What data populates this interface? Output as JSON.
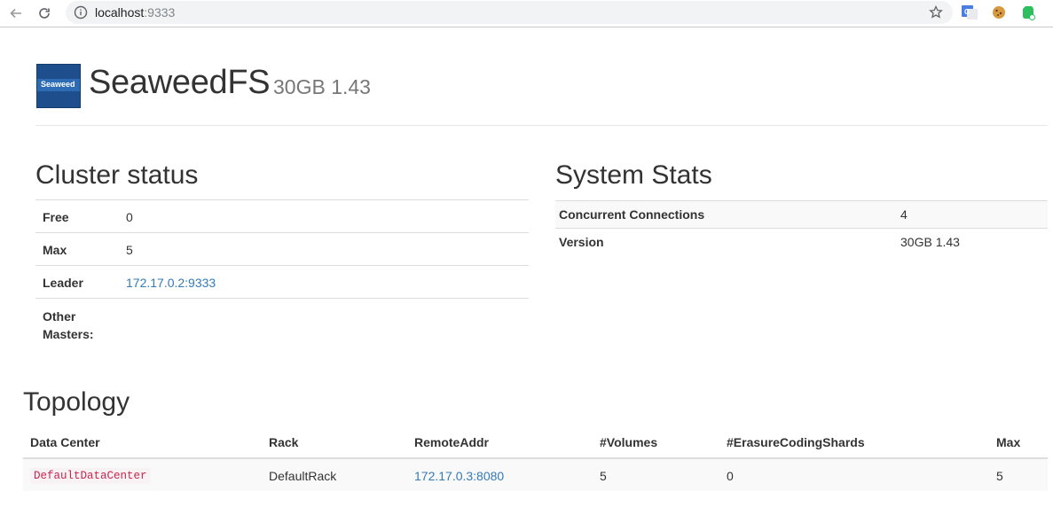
{
  "browser": {
    "url_host": "localhost",
    "url_port": ":9333"
  },
  "header": {
    "logo_text": "Seaweed",
    "title": "SeaweedFS",
    "subtitle": "30GB 1.43"
  },
  "cluster_status": {
    "heading": "Cluster status",
    "rows": [
      {
        "label": "Free",
        "value": "0"
      },
      {
        "label": "Max",
        "value": "5"
      },
      {
        "label": "Leader",
        "value": "172.17.0.2:9333"
      },
      {
        "label": "Other\nMasters:",
        "value": ""
      }
    ]
  },
  "system_stats": {
    "heading": "System Stats",
    "rows": [
      {
        "label": "Concurrent Connections",
        "value": "4"
      },
      {
        "label": "Version",
        "value": "30GB 1.43"
      }
    ]
  },
  "topology": {
    "heading": "Topology",
    "columns": [
      "Data Center",
      "Rack",
      "RemoteAddr",
      "#Volumes",
      "#ErasureCodingShards",
      "Max"
    ],
    "rows": [
      [
        "DefaultDataCenter",
        "DefaultRack",
        "172.17.0.3:8080",
        "5",
        "0",
        "5"
      ]
    ]
  },
  "colors": {
    "link": "#337ab7",
    "code": "#c7254e"
  }
}
